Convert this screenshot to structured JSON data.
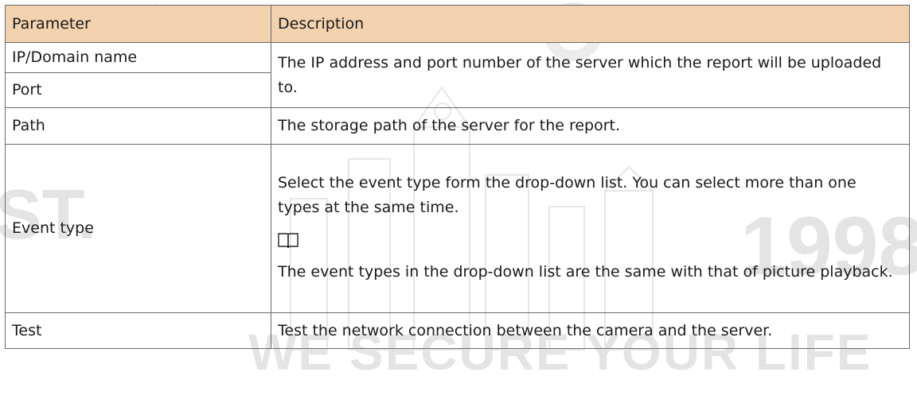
{
  "watermark": {
    "left_fragment": "ST.",
    "right_number": "1998",
    "slogan": "WE SECURE YOUR LIFE"
  },
  "table": {
    "headers": {
      "parameter": "Parameter",
      "description": "Description"
    },
    "rows": {
      "ip_domain": {
        "param": "IP/Domain name"
      },
      "port": {
        "param": "Port"
      },
      "ip_port_desc": {
        "desc": "The IP address and port number of the server which the report will be uploaded to."
      },
      "path": {
        "param": "Path",
        "desc": "The storage path of the server for the report."
      },
      "event_type": {
        "param": "Event type",
        "desc_intro": "Select the event type form the drop-down list. You can select more than one types at the same time.",
        "note_icon": "book-icon",
        "desc_note": "The event types in the drop-down list are the same with that of picture playback."
      },
      "test": {
        "param": "Test",
        "desc": "Test the network connection between the camera and the server."
      }
    }
  }
}
